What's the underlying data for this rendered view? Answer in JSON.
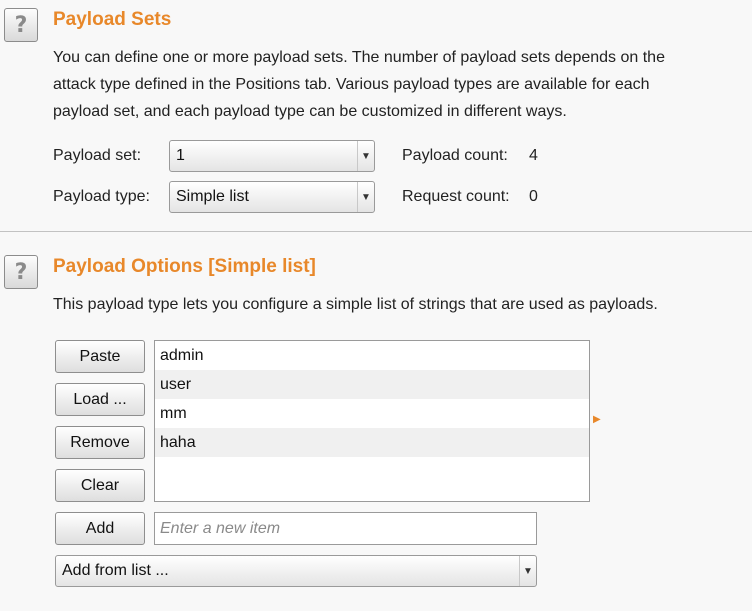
{
  "payload_sets": {
    "help_glyph": "?",
    "title": "Payload Sets",
    "description_lines": [
      "You can define one or more payload sets. The number of payload sets depends on the",
      "attack type defined in the Positions tab. Various payload types are available for each",
      "payload set, and each payload type can be customized in different ways."
    ],
    "set_label": "Payload set:",
    "set_value": "1",
    "type_label": "Payload type:",
    "type_value": "Simple list",
    "count_label": "Payload count:",
    "count_value": "4",
    "request_label": "Request count:",
    "request_value": "0",
    "dropdown_icon": "chevron-down-icon"
  },
  "payload_options": {
    "help_glyph": "?",
    "title": "Payload Options [Simple list]",
    "description": "This payload type lets you configure a simple list of strings that are used as payloads.",
    "buttons": {
      "paste": "Paste",
      "load": "Load ...",
      "remove": "Remove",
      "clear": "Clear",
      "add": "Add"
    },
    "items": [
      "admin",
      "user",
      "mm",
      "haha"
    ],
    "new_item_placeholder": "Enter a new item",
    "add_from_list": "Add from list ..."
  },
  "colors": {
    "accent": "#e8882a",
    "background": "#f8f8f8",
    "alt_row": "#f0f0f0"
  }
}
